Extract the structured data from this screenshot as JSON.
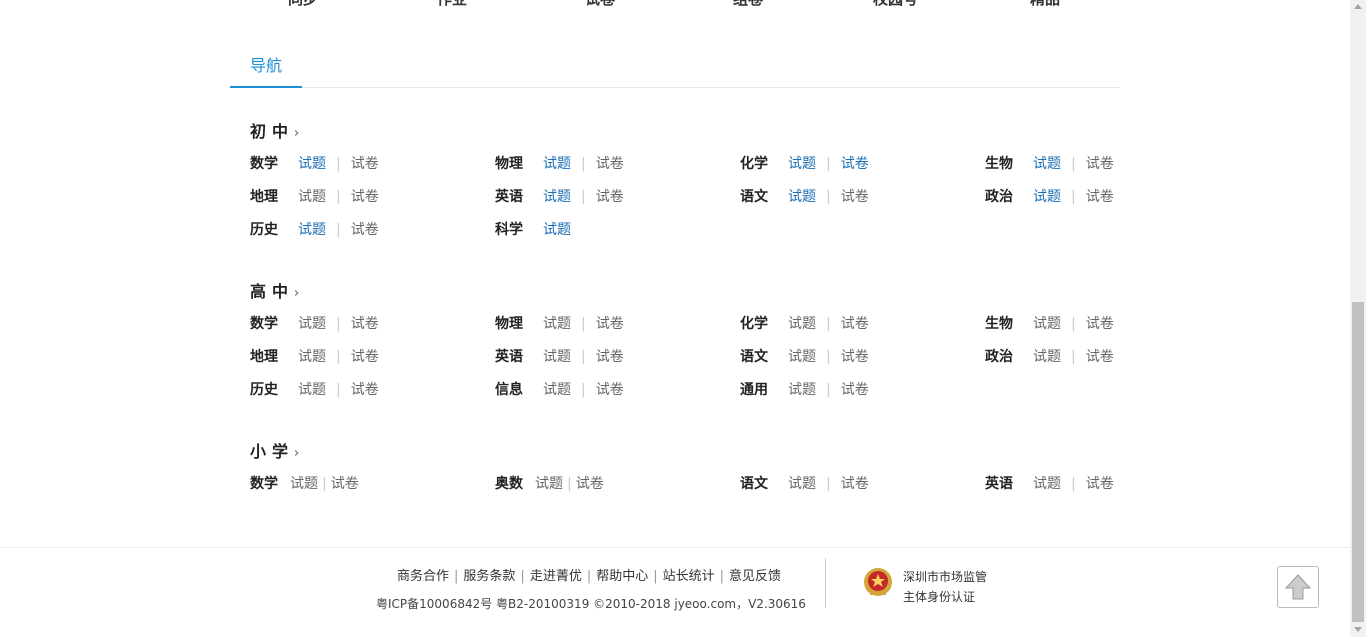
{
  "top_nav": [
    "同步",
    "作业",
    "试卷",
    "组卷",
    "校园号",
    "精品"
  ],
  "tabs": {
    "active": "导航"
  },
  "groups": [
    {
      "title": "初中",
      "chevron": "›",
      "rows": [
        [
          {
            "subject": "数学",
            "t1": "试题",
            "t1_on": true,
            "t2": "试卷",
            "t2_on": false
          },
          {
            "subject": "物理",
            "t1": "试题",
            "t1_on": true,
            "t2": "试卷",
            "t2_on": false
          },
          {
            "subject": "化学",
            "t1": "试题",
            "t1_on": true,
            "t2": "试卷",
            "t2_on": true
          },
          {
            "subject": "生物",
            "t1": "试题",
            "t1_on": true,
            "t2": "试卷",
            "t2_on": false
          }
        ],
        [
          {
            "subject": "地理",
            "t1": "试题",
            "t1_on": false,
            "t2": "试卷",
            "t2_on": false
          },
          {
            "subject": "英语",
            "t1": "试题",
            "t1_on": true,
            "t2": "试卷",
            "t2_on": false
          },
          {
            "subject": "语文",
            "t1": "试题",
            "t1_on": true,
            "t2": "试卷",
            "t2_on": false
          },
          {
            "subject": "政治",
            "t1": "试题",
            "t1_on": true,
            "t2": "试卷",
            "t2_on": false
          }
        ],
        [
          {
            "subject": "历史",
            "t1": "试题",
            "t1_on": true,
            "t2": "试卷",
            "t2_on": false
          },
          {
            "subject": "科学",
            "t1": "试题",
            "t1_on": true,
            "t2": "",
            "t2_on": false
          }
        ]
      ]
    },
    {
      "title": "高中",
      "chevron": "›",
      "rows": [
        [
          {
            "subject": "数学",
            "t1": "试题",
            "t1_on": false,
            "t2": "试卷",
            "t2_on": false
          },
          {
            "subject": "物理",
            "t1": "试题",
            "t1_on": false,
            "t2": "试卷",
            "t2_on": false
          },
          {
            "subject": "化学",
            "t1": "试题",
            "t1_on": false,
            "t2": "试卷",
            "t2_on": false
          },
          {
            "subject": "生物",
            "t1": "试题",
            "t1_on": false,
            "t2": "试卷",
            "t2_on": false
          }
        ],
        [
          {
            "subject": "地理",
            "t1": "试题",
            "t1_on": false,
            "t2": "试卷",
            "t2_on": false
          },
          {
            "subject": "英语",
            "t1": "试题",
            "t1_on": false,
            "t2": "试卷",
            "t2_on": false
          },
          {
            "subject": "语文",
            "t1": "试题",
            "t1_on": false,
            "t2": "试卷",
            "t2_on": false
          },
          {
            "subject": "政治",
            "t1": "试题",
            "t1_on": false,
            "t2": "试卷",
            "t2_on": false
          }
        ],
        [
          {
            "subject": "历史",
            "t1": "试题",
            "t1_on": false,
            "t2": "试卷",
            "t2_on": false
          },
          {
            "subject": "信息",
            "t1": "试题",
            "t1_on": false,
            "t2": "试卷",
            "t2_on": false
          },
          {
            "subject": "通用",
            "t1": "试题",
            "t1_on": false,
            "t2": "试卷",
            "t2_on": false
          }
        ]
      ]
    },
    {
      "title": "小学",
      "chevron": "›",
      "rows": [
        [
          {
            "subject": "数学",
            "t1": "试题",
            "t1_on": false,
            "t2": "试卷",
            "t2_on": false,
            "tight": true
          },
          {
            "subject": "奥数",
            "t1": "试题",
            "t1_on": false,
            "t2": "试卷",
            "t2_on": false,
            "tight": true
          },
          {
            "subject": "语文",
            "t1": "试题",
            "t1_on": false,
            "t2": "试卷",
            "t2_on": false
          },
          {
            "subject": "英语",
            "t1": "试题",
            "t1_on": false,
            "t2": "试卷",
            "t2_on": false
          }
        ]
      ]
    }
  ],
  "footer": {
    "links": [
      "商务合作",
      "服务条款",
      "走进菁优",
      "帮助中心",
      "站长统计",
      "意见反馈"
    ],
    "copyright": "粤ICP备10006842号 粤B2-20100319 ©2010-2018 jyeoo.com，V2.30616",
    "badge_line1": "深圳市市场监管",
    "badge_line2": "主体身份认证"
  },
  "colors": {
    "accent": "#1f8fd9",
    "link_active": "#1a6eb5",
    "link_muted": "#666666"
  }
}
